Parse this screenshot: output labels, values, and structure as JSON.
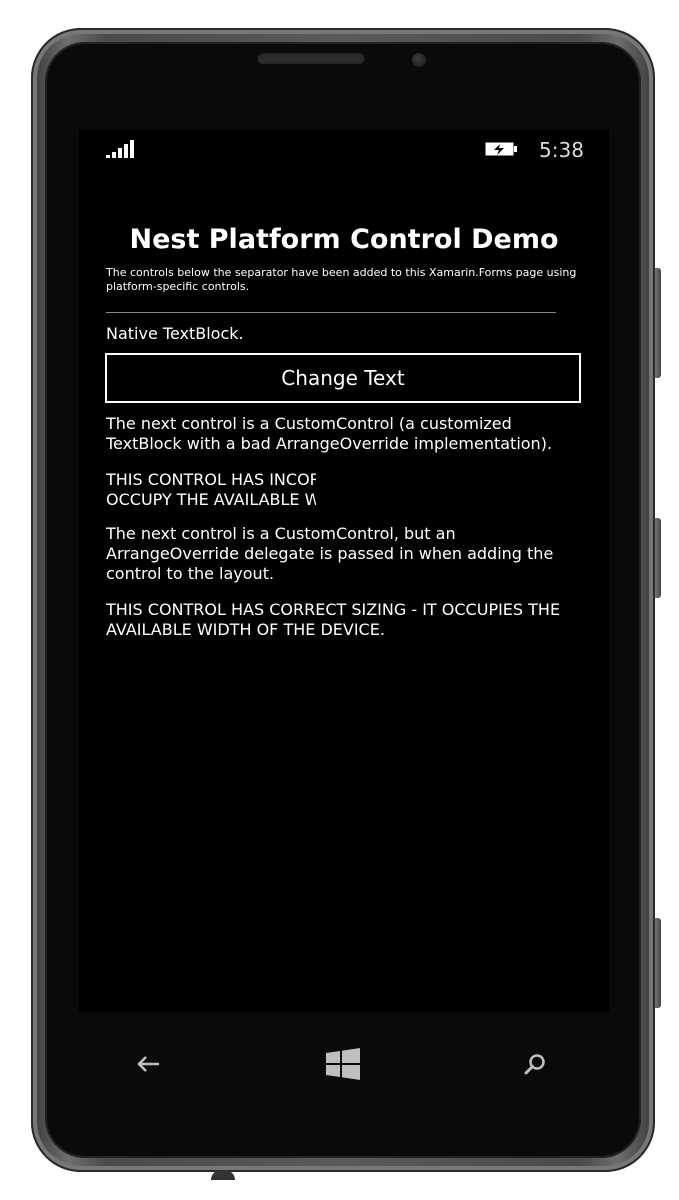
{
  "status_bar": {
    "time": "5:38",
    "signal_icon": "signal-bars-icon",
    "battery_icon": "battery-charging-icon"
  },
  "page": {
    "title": "Nest Platform Control Demo",
    "description": "The controls below the separator have been added to this Xamarin.Forms page using platform-specific controls.",
    "native_textblock": "Native TextBlock.",
    "change_button_label": "Change Text",
    "custom_control_intro": "The next control is a CustomControl (a customized TextBlock with a bad ArrangeOverride implementation).",
    "incorrect_line1": "THIS CONTROL HAS INCORRECT SIZING - IT DOESN'T",
    "incorrect_line2": "OCCUPY THE AVAILABLE WIDTH OF THE DEVICE.",
    "delegate_intro": "The next control is a CustomControl, but an ArrangeOverride delegate is passed in when adding the control to the layout.",
    "correct_text": "THIS CONTROL HAS CORRECT SIZING - IT OCCUPIES THE AVAILABLE WIDTH OF THE DEVICE."
  },
  "nav_bar": {
    "back_icon": "back-arrow-icon",
    "start_icon": "windows-start-icon",
    "search_icon": "search-icon"
  },
  "colors": {
    "screen_background": "#000000",
    "text": "#ffffff",
    "separator": "#888888"
  }
}
